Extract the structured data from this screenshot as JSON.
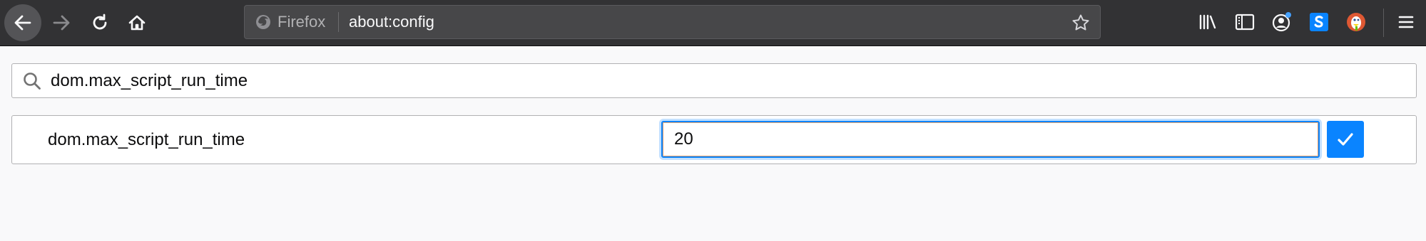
{
  "browser": {
    "identity_label": "Firefox",
    "url": "about:config",
    "icons": {
      "back": "back-arrow-icon",
      "forward": "forward-arrow-icon",
      "reload": "reload-icon",
      "home": "home-icon",
      "bookmark": "star-icon",
      "library": "library-icon",
      "sidebar": "sidebar-icon",
      "account": "account-icon",
      "ext_s": "s-extension-icon",
      "ext_ddg": "duckduckgo-icon",
      "menu": "hamburger-menu-icon"
    },
    "colors": {
      "toolbar": "#323234",
      "urlbar": "#474749",
      "accent": "#0a84ff"
    }
  },
  "config": {
    "search_value": "dom.max_script_run_time",
    "preference": {
      "name": "dom.max_script_run_time",
      "value": "20"
    }
  }
}
